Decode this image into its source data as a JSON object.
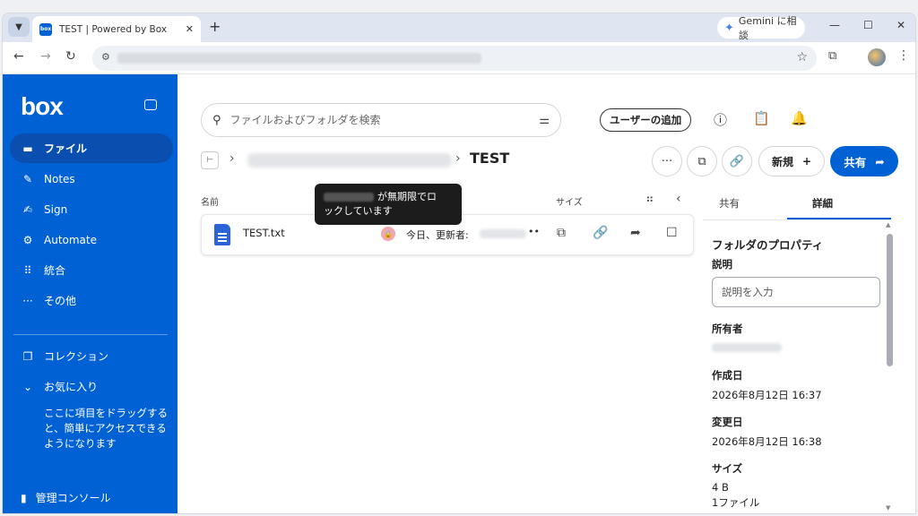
{
  "browser": {
    "tab_title": "TEST | Powered by Box",
    "tab_favicon_text": "box",
    "new_tab": "+",
    "gemini_label": "Gemini に相談"
  },
  "sidebar": {
    "logo": "box",
    "items": [
      {
        "label": "ファイル",
        "icon": "folder-icon",
        "active": true
      },
      {
        "label": "Notes",
        "icon": "notes-icon"
      },
      {
        "label": "Sign",
        "icon": "sign-icon"
      },
      {
        "label": "Automate",
        "icon": "automate-icon"
      },
      {
        "label": "統合",
        "icon": "apps-icon"
      },
      {
        "label": "その他",
        "icon": "more-icon"
      }
    ],
    "collections": "コレクション",
    "favorites": "お気に入り",
    "favorites_hint": "ここに項目をドラッグすると、簡単にアクセスできるようになります",
    "admin": "管理コンソール"
  },
  "header": {
    "search_placeholder": "ファイルおよびフォルダを検索",
    "add_user": "ユーザーの追加"
  },
  "folder": {
    "title": "TEST",
    "new_label": "新規",
    "share_label": "共有"
  },
  "list": {
    "col_name": "名前",
    "col_size": "サイズ",
    "file": {
      "name": "TEST.txt",
      "modified": "今日、更新者:"
    }
  },
  "tooltip": {
    "text1": "が無期限でロ",
    "text2": "ックしています"
  },
  "details": {
    "tab_share": "共有",
    "tab_details": "詳細",
    "heading": "フォルダのプロパティ",
    "desc_label": "説明",
    "desc_placeholder": "説明を入力",
    "owner_label": "所有者",
    "created_label": "作成日",
    "created_value": "2026年8月12日 16:37",
    "modified_label": "変更日",
    "modified_value": "2026年8月12日 16:38",
    "size_label": "サイズ",
    "size_value": "4 B",
    "count_value": "1ファイル"
  },
  "colors": {
    "brand": "#0061d5",
    "lock_badge": "#f2a6ad"
  }
}
